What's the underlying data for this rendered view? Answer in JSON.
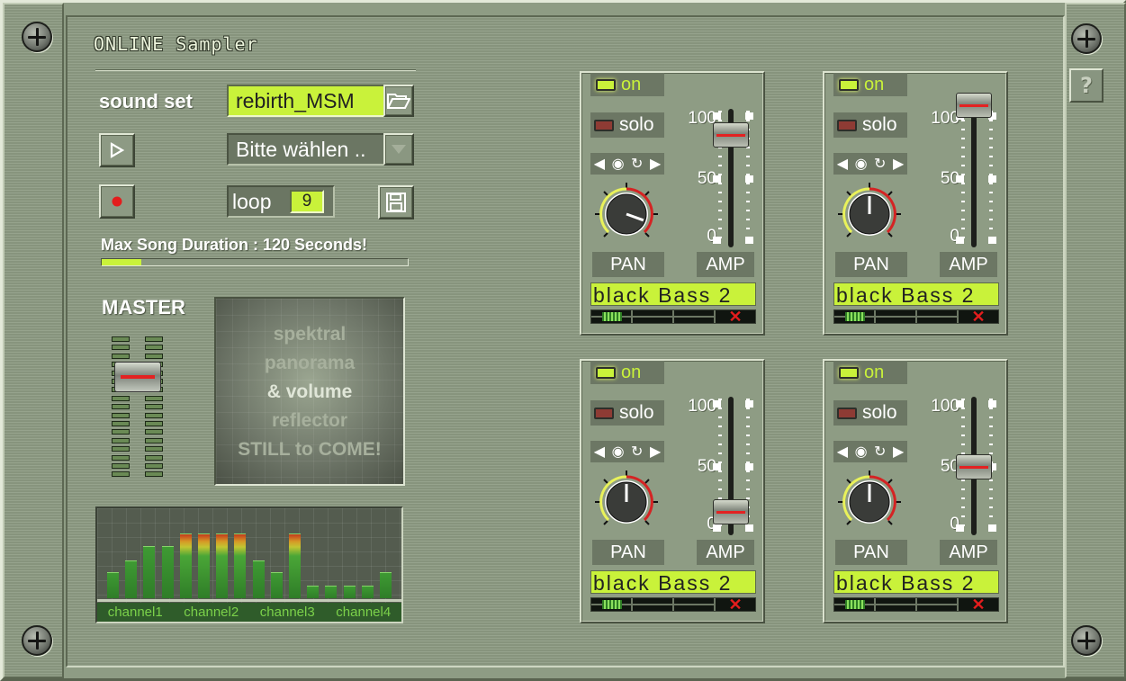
{
  "app": {
    "title": "ONLINE Sampler",
    "help_label": "?"
  },
  "controls": {
    "sound_set_label": "sound set",
    "sound_set_value": "rebirth_MSM",
    "song_select_value": "Bitte wählen ..",
    "loop_label": "loop",
    "loop_value": "9",
    "max_duration_text": "Max Song Duration : 120 Seconds!",
    "song_progress_fraction": 0.13
  },
  "master": {
    "label": "MASTER",
    "fader_level_fraction": 0.78,
    "spectral_lines": [
      "spektral",
      "panorama",
      "& volume",
      "reflector",
      "STILL to COME!"
    ]
  },
  "equalizer": {
    "levels": [
      0.33,
      0.48,
      0.66,
      0.66,
      0.82,
      0.82,
      0.82,
      0.82,
      0.48,
      0.33,
      0.82,
      0.16,
      0.16,
      0.16,
      0.16,
      0.33
    ],
    "channel_labels": [
      "channel1",
      "channel2",
      "channel3",
      "channel4"
    ]
  },
  "channels": [
    {
      "on_label": "on",
      "solo_label": "solo",
      "pan_label": "PAN",
      "amp_label": "AMP",
      "sample_name": "black Bass 2",
      "remove_icon": "✕",
      "scale": [
        "100",
        "50",
        "0"
      ],
      "amp_level": 75,
      "pan_angle": 110,
      "on": true,
      "solo": false
    },
    {
      "on_label": "on",
      "solo_label": "solo",
      "pan_label": "PAN",
      "amp_label": "AMP",
      "sample_name": "black Bass 2",
      "remove_icon": "✕",
      "scale": [
        "100",
        "50",
        "0"
      ],
      "amp_level": 100,
      "pan_angle": 0,
      "on": true,
      "solo": false
    },
    {
      "on_label": "on",
      "solo_label": "solo",
      "pan_label": "PAN",
      "amp_label": "AMP",
      "sample_name": "black Bass 2",
      "remove_icon": "✕",
      "scale": [
        "100",
        "50",
        "0"
      ],
      "amp_level": 0,
      "pan_angle": 0,
      "on": true,
      "solo": false
    },
    {
      "on_label": "on",
      "solo_label": "solo",
      "pan_label": "PAN",
      "amp_label": "AMP",
      "sample_name": "black Bass 2",
      "remove_icon": "✕",
      "scale": [
        "100",
        "50",
        "0"
      ],
      "amp_level": 38,
      "pan_angle": 0,
      "on": true,
      "solo": false
    }
  ],
  "colors": {
    "accent_lime": "#c9f23a",
    "panel": "#8e9c84",
    "record_red": "#e31d1d"
  }
}
